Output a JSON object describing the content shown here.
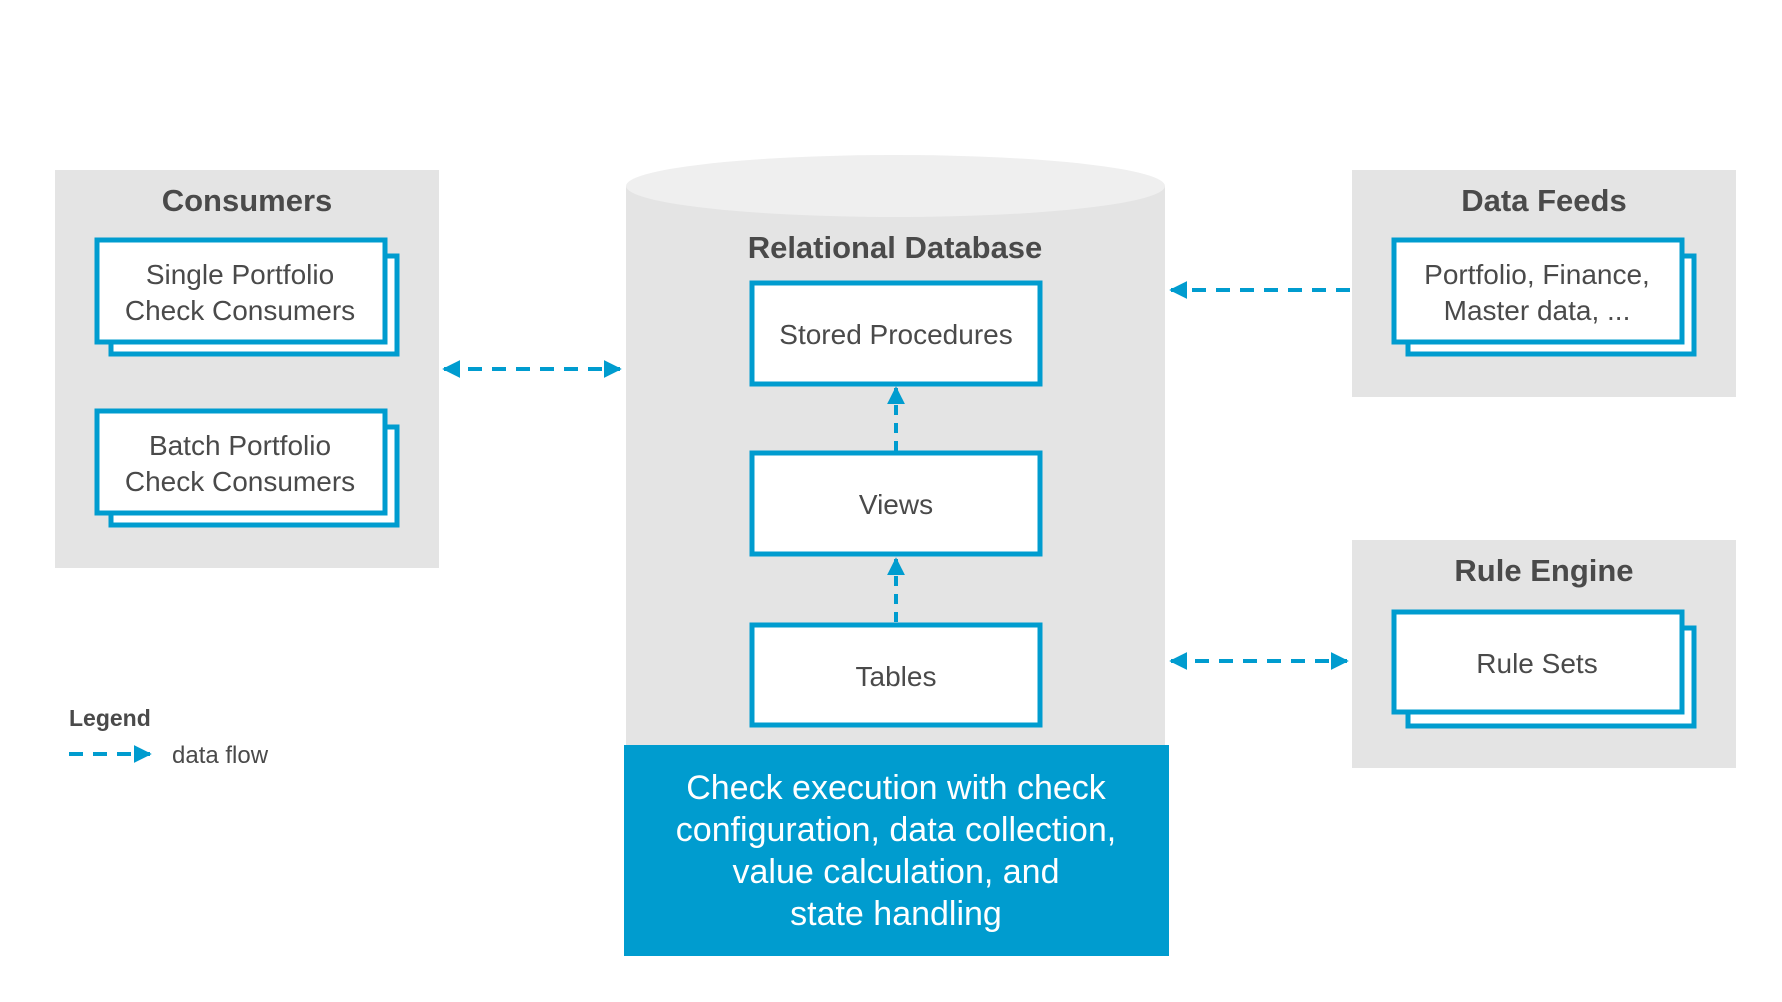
{
  "colors": {
    "accent": "#009ccf",
    "panel": "#e4e4e4",
    "text": "#4a4a4a"
  },
  "consumers": {
    "title": "Consumers",
    "cards": [
      {
        "line1": "Single Portfolio",
        "line2": "Check Consumers"
      },
      {
        "line1": "Batch Portfolio",
        "line2": "Check Consumers"
      }
    ]
  },
  "database": {
    "title": "Relational Database",
    "layers": [
      "Stored Procedures",
      "Views",
      "Tables"
    ],
    "execution": [
      "Check execution with check",
      "configuration, data collection,",
      "value calculation, and",
      "state handling"
    ]
  },
  "data_feeds": {
    "title": "Data Feeds",
    "card": {
      "line1": "Portfolio, Finance,",
      "line2": "Master data, ..."
    }
  },
  "rule_engine": {
    "title": "Rule Engine",
    "card": "Rule Sets"
  },
  "legend": {
    "title": "Legend",
    "items": [
      {
        "icon": "dashed-arrow",
        "label": "data flow"
      }
    ]
  }
}
